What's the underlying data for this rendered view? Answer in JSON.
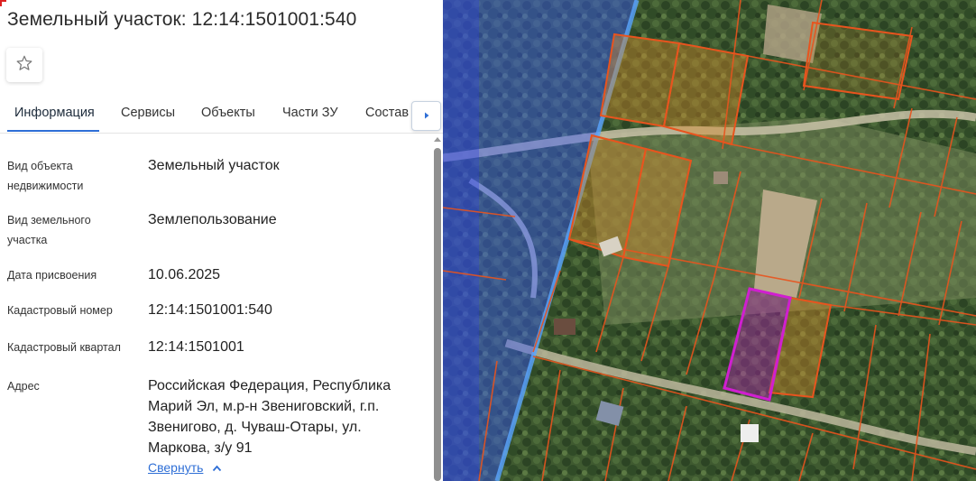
{
  "header": {
    "title": "Земельный участок: 12:14:1501001:540"
  },
  "tabs": [
    {
      "label": "Информация"
    },
    {
      "label": "Сервисы"
    },
    {
      "label": "Объекты"
    },
    {
      "label": "Части ЗУ"
    },
    {
      "label": "Состав"
    }
  ],
  "details": {
    "object_type_label": "Вид объекта недвижимости",
    "object_type_value": "Земельный участок",
    "land_type_label": "Вид земельного участка",
    "land_type_value": "Землепользование",
    "date_label": "Дата присвоения",
    "date_value": "10.06.2025",
    "cad_number_label": "Кадастровый номер",
    "cad_number_value": "12:14:1501001:540",
    "cad_block_label": "Кадастровый квартал",
    "cad_block_value": "12:14:1501001",
    "address_label": "Адрес",
    "address_lines": [
      "Российская Федерация, Республика",
      "Марий Эл, м.р-н Звениговский, г.п.",
      "Звенигово, д. Чуваш-Отары, ул.",
      "Маркова, з/у 91"
    ]
  },
  "collapse_link": "Свернуть",
  "colors": {
    "accent": "#2f6fd6",
    "parcel_border": "#e8541e",
    "selected_parcel": "#c81fc8",
    "water_overlay": "#3a5cff"
  },
  "icons": {
    "favorite": "star-outline-icon",
    "next": "chevron-right-icon",
    "collapse": "chevron-up-icon"
  }
}
